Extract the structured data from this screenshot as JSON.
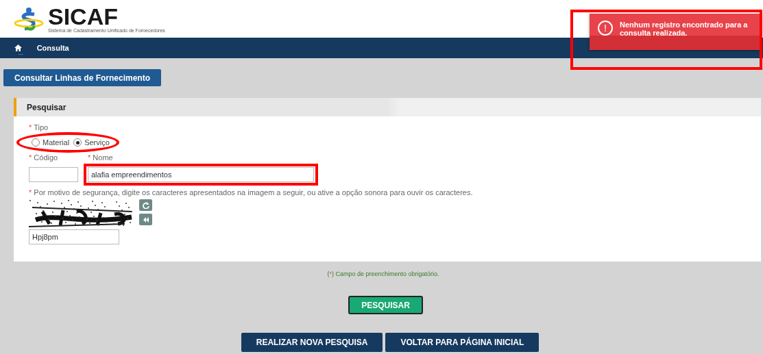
{
  "header": {
    "logo_title": "SICAF",
    "logo_subtitle": "Sistema de Cadastramento Unificado de Fornecedores"
  },
  "nav": {
    "item": "Consulta",
    "more": "..."
  },
  "toast": {
    "message": "Nenhum registro encontrado para a consulta realizada.",
    "icon": "!"
  },
  "page_tab": "Consultar Linhas de Fornecimento",
  "panel": {
    "title": "Pesquisar",
    "tipo": {
      "required": "*",
      "label": "Tipo",
      "options": [
        {
          "label": "Material",
          "selected": false
        },
        {
          "label": "Serviço",
          "selected": true
        }
      ]
    },
    "codigo": {
      "required": "*",
      "label": "Código"
    },
    "nome": {
      "required": "*",
      "label": "Nome",
      "value": "alafia empreendimentos"
    },
    "captcha": {
      "required": "*",
      "instruction": "Por motivo de segurança, digite os caracteres apresentados na imagem a seguir, ou ative a opção sonora para ouvir os caracteres.",
      "value": "Hpj8pm"
    }
  },
  "required_note": [
    {
      "kind": "plain",
      "text": "("
    },
    {
      "kind": "mark",
      "text": "*"
    },
    {
      "kind": "plain",
      "text": ") Campo de preenchimento obrigatório."
    }
  ],
  "search_button": "PESQUISAR",
  "footer_buttons": [
    "REALIZAR NOVA PESQUISA",
    "VOLTAR PARA PÁGINA INICIAL"
  ],
  "annotations": [
    {
      "kind": "box"
    },
    {
      "kind": "ellipse"
    },
    {
      "kind": "box"
    }
  ]
}
